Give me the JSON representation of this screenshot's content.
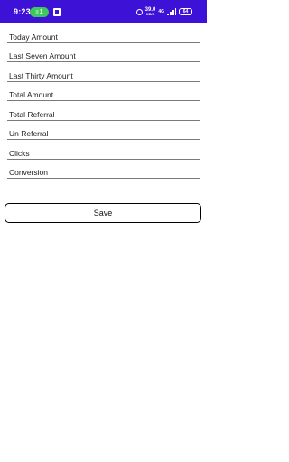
{
  "status_bar": {
    "time": "9:23",
    "notification_count": "1",
    "net_speed_value": "39.0",
    "net_speed_unit": "KB/S",
    "network_type": "4G",
    "battery_level": "64",
    "background_color": "#3d12d6"
  },
  "form": {
    "fields": [
      {
        "placeholder": "Today Amount"
      },
      {
        "placeholder": "Last Seven Amount"
      },
      {
        "placeholder": "Last Thirty Amount"
      },
      {
        "placeholder": "Total Amount"
      },
      {
        "placeholder": "Total Referral"
      },
      {
        "placeholder": "Un Referral"
      },
      {
        "placeholder": "Clicks"
      },
      {
        "placeholder": "Conversion"
      }
    ],
    "save_label": "Save"
  }
}
